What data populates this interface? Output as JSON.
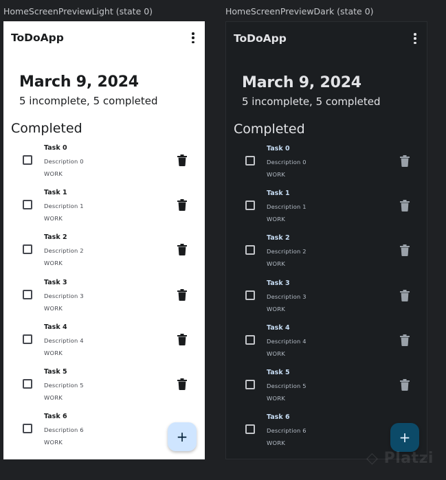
{
  "previews": [
    {
      "theme": "light",
      "label": "HomeScreenPreviewLight (state 0)",
      "app_title": "ToDoApp",
      "date": "March 9, 2024",
      "summary": "5 incomplete, 5 completed",
      "section_title": "Completed",
      "fab_label": "+",
      "colors": {
        "background": "#ffffff",
        "fab": "#cfe5ff",
        "trash": "#1a1c1e"
      },
      "tasks": [
        {
          "name": "Task 0",
          "description": "Description 0",
          "category": "WORK",
          "checked": false
        },
        {
          "name": "Task 1",
          "description": "Description 1",
          "category": "WORK",
          "checked": false
        },
        {
          "name": "Task 2",
          "description": "Description 2",
          "category": "WORK",
          "checked": false
        },
        {
          "name": "Task 3",
          "description": "Description 3",
          "category": "WORK",
          "checked": false
        },
        {
          "name": "Task 4",
          "description": "Description 4",
          "category": "WORK",
          "checked": false
        },
        {
          "name": "Task 5",
          "description": "Description 5",
          "category": "WORK",
          "checked": false
        },
        {
          "name": "Task 6",
          "description": "Description 6",
          "category": "WORK",
          "checked": false
        }
      ]
    },
    {
      "theme": "dark",
      "label": "HomeScreenPreviewDark (state 0)",
      "app_title": "ToDoApp",
      "date": "March 9, 2024",
      "summary": "5 incomplete, 5 completed",
      "section_title": "Completed",
      "fab_label": "+",
      "colors": {
        "background": "#1b1e21",
        "fab": "#0c4a68",
        "trash": "#9aa1a9"
      },
      "tasks": [
        {
          "name": "Task 0",
          "description": "Description 0",
          "category": "WORK",
          "checked": false
        },
        {
          "name": "Task 1",
          "description": "Description 1",
          "category": "WORK",
          "checked": false
        },
        {
          "name": "Task 2",
          "description": "Description 2",
          "category": "WORK",
          "checked": false
        },
        {
          "name": "Task 3",
          "description": "Description 3",
          "category": "WORK",
          "checked": false
        },
        {
          "name": "Task 4",
          "description": "Description 4",
          "category": "WORK",
          "checked": false
        },
        {
          "name": "Task 5",
          "description": "Description 5",
          "category": "WORK",
          "checked": false
        },
        {
          "name": "Task 6",
          "description": "Description 6",
          "category": "WORK",
          "checked": false
        }
      ]
    }
  ],
  "icons": {
    "menu": "more-vert-icon",
    "checkbox": "checkbox-outline-icon",
    "delete": "trash-icon",
    "add": "plus-icon",
    "watermark": "platzi-logo"
  },
  "watermark_text": "Platzi"
}
